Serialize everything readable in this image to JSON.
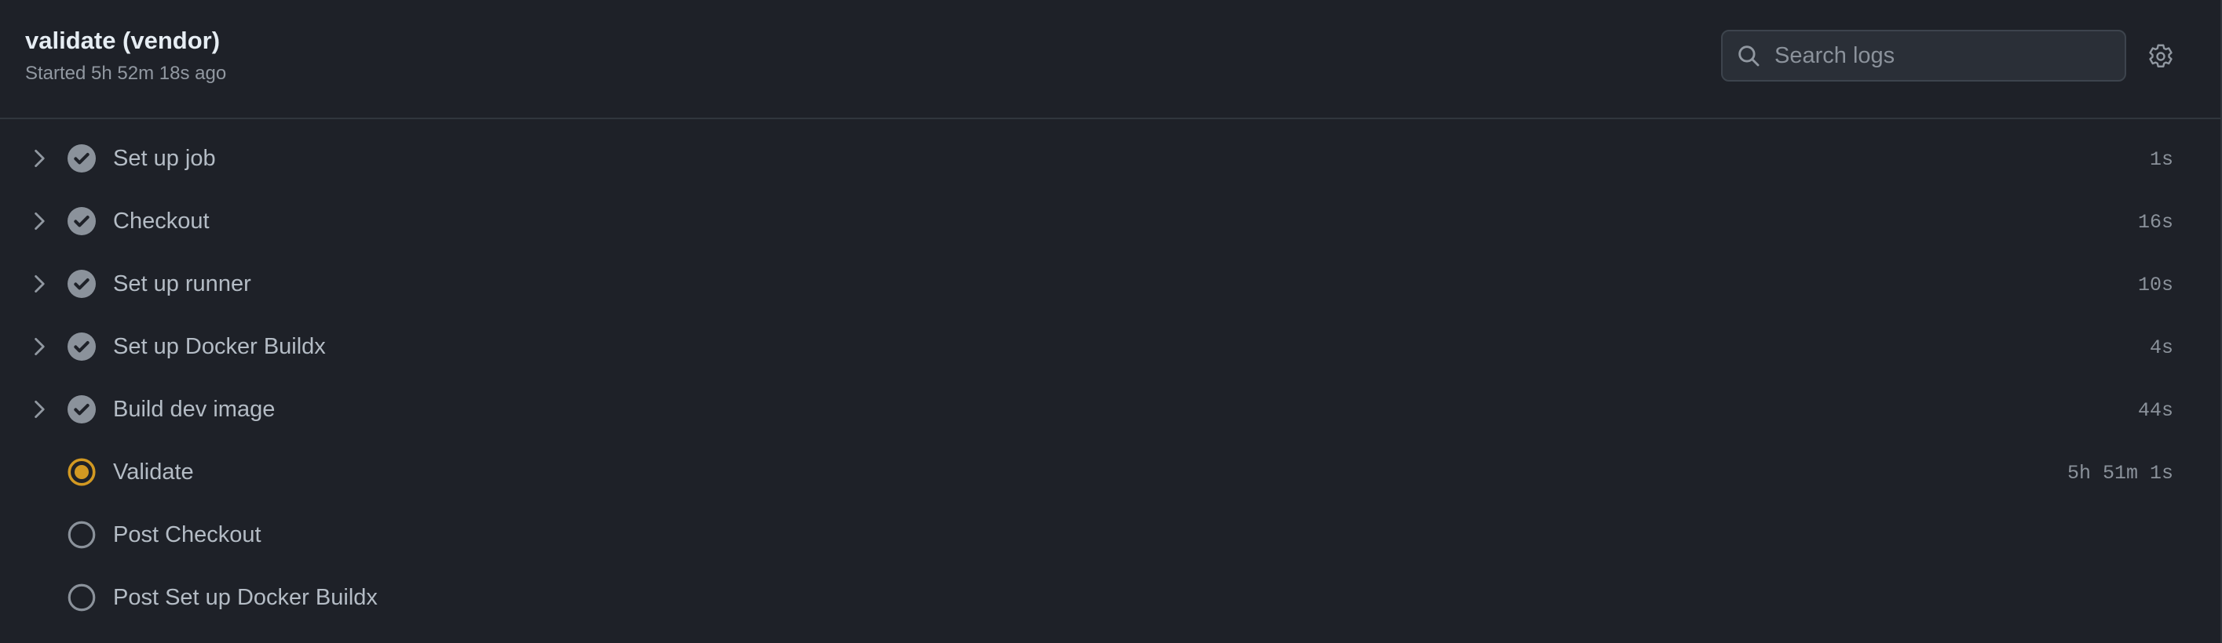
{
  "job": {
    "title": "validate (vendor)",
    "subtitle": "Started 5h 52m 18s ago"
  },
  "search": {
    "placeholder": "Search logs",
    "value": "",
    "icon": "search-icon"
  },
  "settings": {
    "icon": "gear-icon"
  },
  "colors": {
    "background": "#1e2128",
    "border": "#30363d",
    "success_icon": "#8b929b",
    "in_progress": "#d29922",
    "pending": "#8b929b"
  },
  "steps": [
    {
      "label": "Set up job",
      "duration": "1s",
      "status": "success",
      "expandable": true
    },
    {
      "label": "Checkout",
      "duration": "16s",
      "status": "success",
      "expandable": true
    },
    {
      "label": "Set up runner",
      "duration": "10s",
      "status": "success",
      "expandable": true
    },
    {
      "label": "Set up Docker Buildx",
      "duration": "4s",
      "status": "success",
      "expandable": true
    },
    {
      "label": "Build dev image",
      "duration": "44s",
      "status": "success",
      "expandable": true
    },
    {
      "label": "Validate",
      "duration": "5h 51m 1s",
      "status": "in_progress",
      "expandable": false
    },
    {
      "label": "Post Checkout",
      "duration": "",
      "status": "pending",
      "expandable": false
    },
    {
      "label": "Post Set up Docker Buildx",
      "duration": "",
      "status": "pending",
      "expandable": false
    }
  ]
}
